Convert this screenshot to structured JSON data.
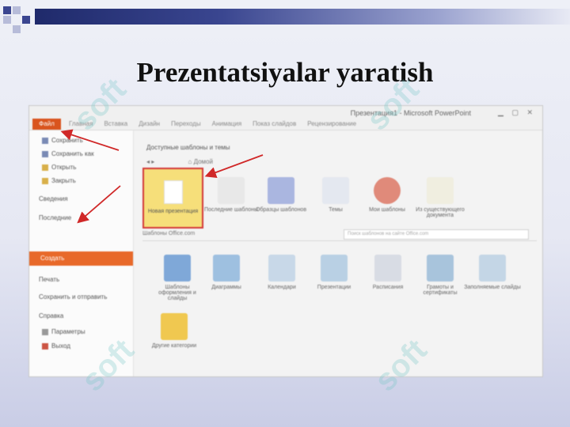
{
  "slide": {
    "title": "Prezentatsiyalar yaratish"
  },
  "window": {
    "title": "Презентация1 - Microsoft PowerPoint",
    "file_tab": "Файл",
    "ribbon_tabs": [
      "Главная",
      "Вставка",
      "Дизайн",
      "Переходы",
      "Анимация",
      "Показ слайдов",
      "Рецензирование"
    ]
  },
  "left_menu": [
    {
      "label": "Сохранить",
      "icon": "save-icon"
    },
    {
      "label": "Сохранить как",
      "icon": "save-as-icon"
    },
    {
      "label": "Открыть",
      "icon": "open-folder-icon"
    },
    {
      "label": "Закрыть",
      "icon": "close-doc-icon"
    },
    {
      "label": "Сведения",
      "icon": ""
    },
    {
      "label": "Последние",
      "icon": ""
    },
    {
      "label": "Создать",
      "icon": "",
      "selected": true
    },
    {
      "label": "Печать",
      "icon": ""
    },
    {
      "label": "Сохранить и отправить",
      "icon": ""
    },
    {
      "label": "Справка",
      "icon": ""
    },
    {
      "label": "Параметры",
      "icon": "options-icon"
    },
    {
      "label": "Выход",
      "icon": "exit-icon"
    }
  ],
  "main": {
    "heading": "Доступные шаблоны и темы",
    "nav_home": "Домой",
    "top_templates": [
      {
        "label": "Новая презентация",
        "icon": "blank-document-icon",
        "selected": true
      },
      {
        "label": "Последние шаблоны",
        "icon": "recent-templates-icon"
      },
      {
        "label": "Образцы шаблонов",
        "icon": "sample-templates-icon"
      },
      {
        "label": "Темы",
        "icon": "themes-icon"
      },
      {
        "label": "Мои шаблоны",
        "icon": "my-templates-icon"
      },
      {
        "label": "Из существующего документа",
        "icon": "existing-document-icon"
      }
    ],
    "office_section": "Шаблоны Office.com",
    "office_search_placeholder": "Поиск шаблонов на сайте Office.com",
    "office_templates": [
      {
        "label": "Шаблоны оформления и слайды",
        "icon": "design-slides-icon"
      },
      {
        "label": "Диаграммы",
        "icon": "diagrams-icon"
      },
      {
        "label": "Календари",
        "icon": "calendars-icon"
      },
      {
        "label": "Презентации",
        "icon": "presentations-icon"
      },
      {
        "label": "Расписания",
        "icon": "schedules-icon"
      },
      {
        "label": "Грамоты и сертификаты",
        "icon": "certificates-icon"
      },
      {
        "label": "Заполняемые слайды",
        "icon": "content-slides-icon"
      },
      {
        "label": "Другие категории",
        "icon": "folder-icon"
      }
    ]
  },
  "watermark": "soft"
}
